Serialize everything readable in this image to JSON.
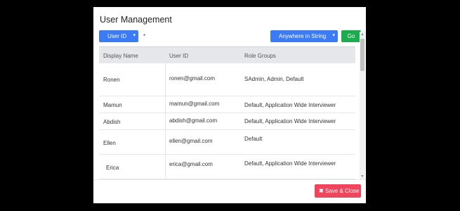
{
  "modal": {
    "title": "User Management"
  },
  "search": {
    "type_label": "User ID",
    "value": "*",
    "match_mode": "Anywhere in String",
    "go_label": "Go"
  },
  "table": {
    "columns": [
      "Display Name",
      "User ID",
      "Role Groups"
    ],
    "rows": [
      {
        "name": "Ronen",
        "user_id": "ronen@gmail.com",
        "roles": "SAdmin, Admin, Default"
      },
      {
        "name": "Mamun",
        "user_id": "mamun@gmail.com",
        "roles": "Default, Application Wide Interviewer"
      },
      {
        "name": "Abdish",
        "user_id": "abdish@gmail.com",
        "roles": "Default, Application Wide Interviewer"
      },
      {
        "name": "Ellen",
        "user_id": "ellen@gmail.com",
        "roles": "Default"
      },
      {
        "name": "Erica",
        "user_id": "erica@gmail.com",
        "roles": "Default, Application Wide Interviewer"
      }
    ]
  },
  "footer": {
    "save_close_label": "Save & Close"
  },
  "colors": {
    "primary": "#3b7bf5",
    "success": "#1eaa4e",
    "danger": "#f0455c"
  },
  "icons": {
    "dropdown": "caret-down-icon",
    "save_close": "close-icon"
  }
}
